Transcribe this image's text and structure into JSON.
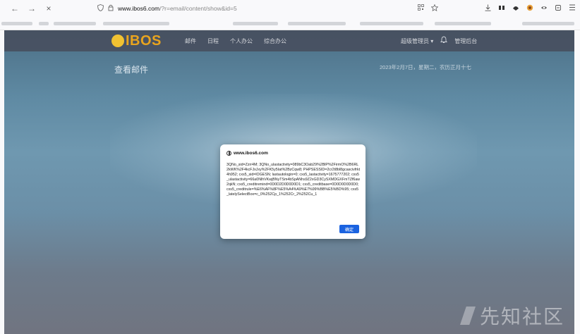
{
  "browser": {
    "back_glyph": "←",
    "forward_glyph": "→",
    "close_glyph": "×",
    "url_host": "www.ibos6.com",
    "url_path": "/?r=email/content/show&id=5",
    "icons": [
      "shield-icon",
      "lock-icon",
      "qr-icon",
      "star-icon",
      "download-icon",
      "extension-icon",
      "extension-icon",
      "extension-icon",
      "extension-icon",
      "extension-icon",
      "menu-icon"
    ]
  },
  "app": {
    "logo_text": "IBOS",
    "nav": [
      "邮件",
      "日程",
      "个人办公",
      "综合办公"
    ],
    "user_label": "超级管理员",
    "admin_label": "管理后台",
    "page_title": "查看邮件",
    "date_text": "2023年2月7日，星期二，农历正月十七"
  },
  "dialog": {
    "origin": "www.ibos6.com",
    "message": "3QNo_sid=Zzrr4M; 3QNo_ulastactivity=089bC3Oab29%2BlP%2FirmO%2B6RL2kWK%2F4kcFJxJxy%2FK5y5Iat%2BzCqw8; PHPSESSID=2cr2t8bl8gcascivfrkt4h952; cxs5_sid=lOGESN; lastautologin=0; cxs5_lastactivity=1675777202; cxs5_ulastactivity=66a0NlhVKwjBNyTSm4bSpANhs9Z2xGD3CySXMDGXFmTZf6aw2qkN; cxs5_creditremind=0D0D2D0D0D0D1; cxs5_creditbase=0D0D0D0D0D0; cxs5_creditrule=%E6%AF%8F%E5%A4%A9%E7%99%BB%E5%BD%95; cxs5_latelySelectBox=c_0%252Cp_1%252Cr_2%252Cu_1",
    "ok_label": "确定"
  },
  "watermark": {
    "text": "先知社区"
  },
  "colors": {
    "accent": "#1b63e0",
    "logo": "#e9a41e"
  }
}
